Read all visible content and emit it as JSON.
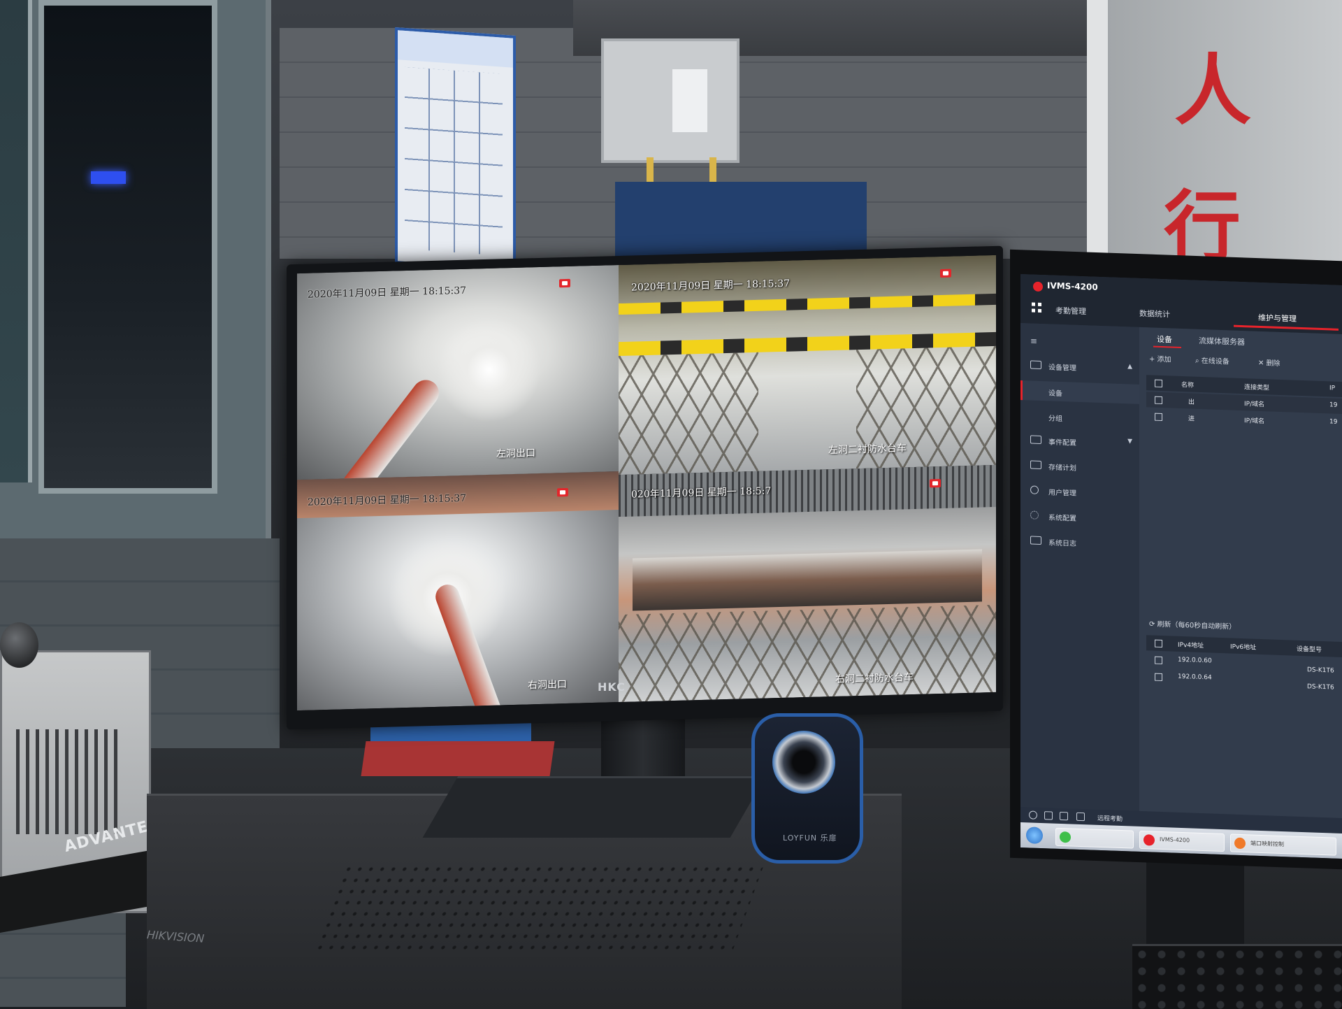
{
  "scene": {
    "monitor_brand": "HKC",
    "speaker_brand": "LOYFUN 乐扉",
    "pc_brand": "ADVANTECH",
    "nvr_brand": "HIKVISION",
    "door_chars": [
      "人",
      "行"
    ]
  },
  "cameras": [
    {
      "timestamp": "2020年11月09日  星期一  18:15:37",
      "label": "左洞出口"
    },
    {
      "timestamp": "2020年11月09日  星期一  18:15:37",
      "label": "左洞二衬防水台车"
    },
    {
      "timestamp": "2020年11月09日  星期一  18:15:37",
      "label": "右洞出口"
    },
    {
      "timestamp": "020年11月09日  星期一  18:5:7",
      "label": "右洞二衬防水台车"
    }
  ],
  "ivms": {
    "app_title": "IVMS-4200",
    "nav": [
      "考勤管理",
      "数据统计",
      "维护与管理"
    ],
    "sidebar": [
      {
        "label": "设备管理",
        "icon": "monitor-icon",
        "arrow": "▲"
      },
      {
        "label": "设备",
        "icon": "",
        "arrow": ""
      },
      {
        "label": "分组",
        "icon": "",
        "arrow": ""
      },
      {
        "label": "事件配置",
        "icon": "event-icon",
        "arrow": "▼"
      },
      {
        "label": "存储计划",
        "icon": "storage-icon",
        "arrow": ""
      },
      {
        "label": "用户管理",
        "icon": "user-icon",
        "arrow": ""
      },
      {
        "label": "系统配置",
        "icon": "gear-icon",
        "arrow": ""
      },
      {
        "label": "系统日志",
        "icon": "log-icon",
        "arrow": ""
      }
    ],
    "tabs": [
      "设备",
      "流媒体服务器"
    ],
    "toolbar": {
      "add": "+ 添加",
      "online": "在线设备",
      "delete": "删除"
    },
    "table_headers": [
      "名称",
      "连接类型",
      "IP"
    ],
    "devices": [
      {
        "name": "出",
        "type": "IP/域名",
        "ip": "19"
      },
      {
        "name": "进",
        "type": "IP/域名",
        "ip": "19"
      }
    ],
    "refresh_label": "刷新（每60秒自动刷新）",
    "online_headers": [
      "IPv4地址",
      "IPv6地址",
      "设备型号"
    ],
    "online_devices": [
      {
        "ipv4": "192.0.0.60",
        "model": "DS-K1T6"
      },
      {
        "ipv4": "192.0.0.64",
        "model": "DS-K1T6"
      }
    ],
    "status_text": "远程考勤",
    "taskbar": [
      "IVMS-4200",
      "端口映射控制"
    ]
  }
}
